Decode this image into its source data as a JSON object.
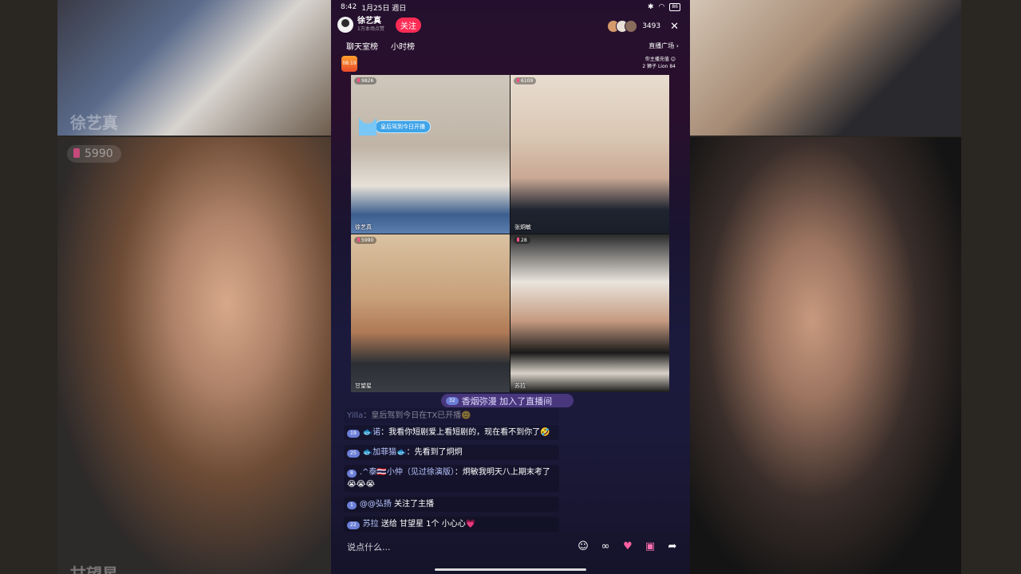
{
  "status": {
    "time": "8:42",
    "date": "1月25日 週日",
    "battery": "86"
  },
  "host": {
    "name": "徐艺真",
    "sub": "1万本场点赞",
    "follow_label": "关注"
  },
  "viewers": {
    "count": "3493"
  },
  "tabs": [
    "聊天室榜",
    "小时榜"
  ],
  "plaza": {
    "label": "直播广场 ›"
  },
  "rank": {
    "line1": "你主播充值 😊",
    "line2": "2 狮子 Lion 84"
  },
  "gift_badge": "08:19",
  "participants": [
    {
      "name": "徐艺真",
      "badge": "9826",
      "tag": "皇后驾到今日开播"
    },
    {
      "name": "张炯敏",
      "badge": "6109"
    },
    {
      "name": "甘望星",
      "badge": "5990"
    },
    {
      "name": "苏拉",
      "badge": "28"
    }
  ],
  "join_message": {
    "level": "32",
    "text": "香烟弥漫 加入了直播间"
  },
  "chat": [
    {
      "level": "",
      "user": "Yilla",
      "text": "：皇后驾到今日在TX已开播🙂"
    },
    {
      "level": "19",
      "user": "🐟诺",
      "text": "：我看你短剧爱上看短剧的，现在看不到你了🤣"
    },
    {
      "level": "25",
      "user": "🐟加菲猫🐟",
      "text": "：先看到了炯炯"
    },
    {
      "level": "8",
      "user": ".^泰🇹🇭小仲（见过徐演版）",
      "text": "：炯敏我明天八上期末考了😭😭😭"
    },
    {
      "level": "1",
      "user": "@@弘扬",
      "text": " 关注了主播"
    },
    {
      "level": "22",
      "user": "苏拉",
      "text": " 送给 甘望星 1个 小心心💗"
    }
  ],
  "input": {
    "placeholder": "说点什么..."
  },
  "background": {
    "left_top_name": "徐艺真",
    "left_badge": "5990",
    "left_bottom_name": "甘望星"
  }
}
